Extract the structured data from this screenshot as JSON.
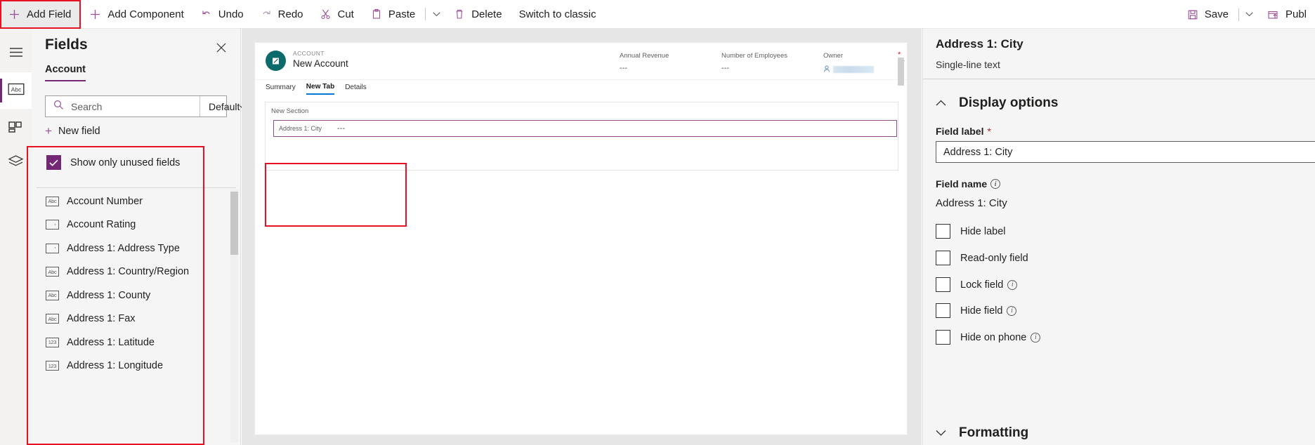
{
  "commandbar": {
    "add_field": "Add Field",
    "add_component": "Add Component",
    "undo": "Undo",
    "redo": "Redo",
    "cut": "Cut",
    "paste": "Paste",
    "delete": "Delete",
    "switch_to_classic": "Switch to classic",
    "save": "Save",
    "publish": "Publ",
    "accent_color": "#9b4f96",
    "highlight_color": "#e81123"
  },
  "rail": {
    "items": [
      {
        "name": "hamburger-menu",
        "icon": "menu-icon"
      },
      {
        "name": "fields",
        "icon": "abc-text-icon",
        "selected": true
      },
      {
        "name": "components",
        "icon": "components-grid-icon"
      },
      {
        "name": "layers",
        "icon": "layers-icon"
      }
    ]
  },
  "fields_panel": {
    "title": "Fields",
    "close_label": "Close",
    "tabs": [
      {
        "label": "Account",
        "active": true
      }
    ],
    "search": {
      "placeholder": "Search",
      "value": ""
    },
    "filter": {
      "selected": "Default"
    },
    "new_field": "New field",
    "show_only_unused": {
      "label": "Show only unused fields",
      "checked": true
    },
    "items": [
      {
        "label": "Account Number",
        "type": "text"
      },
      {
        "label": "Account Rating",
        "type": "optionset"
      },
      {
        "label": "Address 1: Address Type",
        "type": "optionset"
      },
      {
        "label": "Address 1: Country/Region",
        "type": "text"
      },
      {
        "label": "Address 1: County",
        "type": "text"
      },
      {
        "label": "Address 1: Fax",
        "type": "text"
      },
      {
        "label": "Address 1: Latitude",
        "type": "number"
      },
      {
        "label": "Address 1: Longitude",
        "type": "number"
      }
    ],
    "icon_glyphs": {
      "text": "Abc",
      "number": "123",
      "optionset": "·"
    }
  },
  "canvas": {
    "header": {
      "entity": "ACCOUNT",
      "record_name": "New Account",
      "columns": [
        {
          "label": "Annual Revenue",
          "value": "---",
          "required": false
        },
        {
          "label": "Number of Employees",
          "value": "---",
          "required": false
        },
        {
          "label": "Owner",
          "value": "",
          "required": true,
          "redacted": true
        }
      ]
    },
    "tabs": [
      {
        "label": "Summary",
        "active": false
      },
      {
        "label": "New Tab",
        "active": true
      },
      {
        "label": "Details",
        "active": false
      }
    ],
    "section": {
      "title": "New Section",
      "field": {
        "label": "Address 1: City",
        "value": "---"
      }
    }
  },
  "properties": {
    "title": "Address 1: City",
    "subtitle": "Single-line text",
    "display_options": {
      "header": "Display options",
      "expanded": true,
      "field_label": {
        "label": "Field label",
        "required": true,
        "value": "Address 1: City"
      },
      "field_name": {
        "label": "Field name",
        "has_info": true,
        "value": "Address 1: City"
      },
      "checkboxes": [
        {
          "label": "Hide label",
          "checked": false,
          "has_info": false
        },
        {
          "label": "Read-only field",
          "checked": false,
          "has_info": false
        },
        {
          "label": "Lock field",
          "checked": false,
          "has_info": true
        },
        {
          "label": "Hide field",
          "checked": false,
          "has_info": true
        },
        {
          "label": "Hide on phone",
          "checked": false,
          "has_info": true
        }
      ]
    },
    "formatting": {
      "header": "Formatting",
      "expanded": false
    }
  }
}
